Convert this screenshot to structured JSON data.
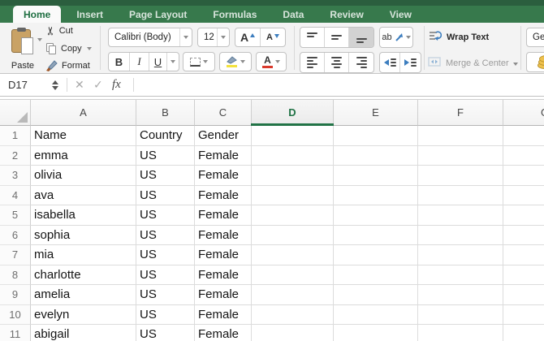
{
  "tabs": [
    {
      "label": "Home",
      "active": true
    },
    {
      "label": "Insert",
      "active": false
    },
    {
      "label": "Page Layout",
      "active": false
    },
    {
      "label": "Formulas",
      "active": false
    },
    {
      "label": "Data",
      "active": false
    },
    {
      "label": "Review",
      "active": false
    },
    {
      "label": "View",
      "active": false
    }
  ],
  "ribbon": {
    "clipboard": {
      "paste": "Paste",
      "cut": "Cut",
      "copy": "Copy",
      "format": "Format"
    },
    "font": {
      "name": "Calibri (Body)",
      "size": "12",
      "bold": "B",
      "italic": "I",
      "underline": "U",
      "grow": "A",
      "shrink": "A"
    },
    "alignment": {
      "orientation": "ab",
      "wrap_text": "Wrap Text",
      "merge_center": "Merge & Center"
    },
    "number": {
      "format_visible": "Ge"
    }
  },
  "formula_bar": {
    "name_box": "D17",
    "cancel": "✕",
    "enter": "✓",
    "fx": "fx",
    "value": ""
  },
  "sheet": {
    "row_header_width": 38,
    "columns": [
      {
        "label": "A",
        "width": 130,
        "selected": false
      },
      {
        "label": "B",
        "width": 72,
        "selected": false
      },
      {
        "label": "C",
        "width": 70,
        "selected": false
      },
      {
        "label": "D",
        "width": 101,
        "selected": true
      },
      {
        "label": "E",
        "width": 104,
        "selected": false
      },
      {
        "label": "F",
        "width": 105,
        "selected": false
      },
      {
        "label": "G",
        "width": 103,
        "selected": false
      }
    ],
    "rows": [
      {
        "num": "1",
        "cells": [
          "Name",
          "Country",
          "Gender",
          "",
          "",
          "",
          ""
        ]
      },
      {
        "num": "2",
        "cells": [
          "emma",
          "US",
          "Female",
          "",
          "",
          "",
          ""
        ]
      },
      {
        "num": "3",
        "cells": [
          "olivia",
          "US",
          "Female",
          "",
          "",
          "",
          ""
        ]
      },
      {
        "num": "4",
        "cells": [
          "ava",
          "US",
          "Female",
          "",
          "",
          "",
          ""
        ]
      },
      {
        "num": "5",
        "cells": [
          "isabella",
          "US",
          "Female",
          "",
          "",
          "",
          ""
        ]
      },
      {
        "num": "6",
        "cells": [
          "sophia",
          "US",
          "Female",
          "",
          "",
          "",
          ""
        ]
      },
      {
        "num": "7",
        "cells": [
          "mia",
          "US",
          "Female",
          "",
          "",
          "",
          ""
        ]
      },
      {
        "num": "8",
        "cells": [
          "charlotte",
          "US",
          "Female",
          "",
          "",
          "",
          ""
        ]
      },
      {
        "num": "9",
        "cells": [
          "amelia",
          "US",
          "Female",
          "",
          "",
          "",
          ""
        ]
      },
      {
        "num": "10",
        "cells": [
          "evelyn",
          "US",
          "Female",
          "",
          "",
          "",
          ""
        ]
      },
      {
        "num": "11",
        "cells": [
          "abigail",
          "US",
          "Female",
          "",
          "",
          "",
          ""
        ]
      }
    ]
  },
  "colors": {
    "accent_green": "#217346",
    "ribbon_green": "#37794c",
    "titlebar_green": "#2b5e3e",
    "accent_blue": "#3d7ebf",
    "fill_yellow": "#f3e23e",
    "font_red": "#d9392c",
    "coin_gold": "#eec14d"
  }
}
